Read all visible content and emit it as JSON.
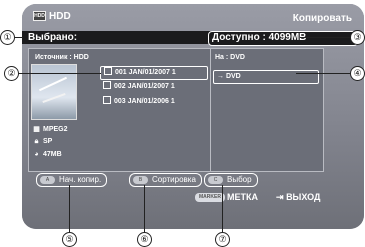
{
  "header": {
    "title": "HDD",
    "action": "Копировать"
  },
  "status": {
    "selected_label": "Выбрано:",
    "available_label": "Доступно : 4099MB"
  },
  "source": {
    "heading": "Источник : HDD",
    "files": [
      {
        "label": "001 JAN/01/2007  1"
      },
      {
        "label": "002 JAN/01/2007  1"
      },
      {
        "label": "003 JAN/01/2006  1"
      }
    ],
    "info": {
      "format": "MPEG2",
      "quality": "SP",
      "size": "47MB"
    }
  },
  "destination": {
    "heading": "На : DVD",
    "item": "→ DVD"
  },
  "buttons": [
    {
      "key": "A",
      "label": "Нач. копир."
    },
    {
      "key": "B",
      "label": "Сортировка"
    },
    {
      "key": "C",
      "label": "Выбор"
    }
  ],
  "footer": {
    "marker_key": "MARKER",
    "marker_label": "МЕТКА",
    "exit_label": "ВЫХОД"
  },
  "callouts": [
    "①",
    "②",
    "③",
    "④",
    "⑤",
    "⑥",
    "⑦"
  ]
}
